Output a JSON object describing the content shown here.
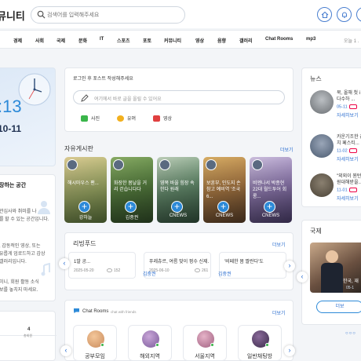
{
  "header": {
    "brand": "뮤니티",
    "search_placeholder": "검색어를 입력해주세요"
  },
  "nav": {
    "items": [
      "경제",
      "사회",
      "국제",
      "문화",
      "IT",
      "스포츠",
      "포토",
      "커뮤니티",
      "영상",
      "음향",
      "갤러리",
      "Chat Rooms",
      "mp3"
    ],
    "date": "오늘 1 ."
  },
  "clock": {
    "time": ":13",
    "date": "10-11"
  },
  "intro": {
    "title": "장하는 공간",
    "line1": "관심사와 취미를 나",
    "line2": "를 할 수 있는 공간입니다.",
    "line3": ", 감동적인 영상, 또는",
    "line4": "유롭게 업로드하고 감상",
    "line5": "갤러리입니다.",
    "line6": "미니, 회원 활동 소식",
    "line7": "보를 놓치지 마세요."
  },
  "stat": {
    "value": "4",
    "label": "총회원"
  },
  "post": {
    "title": "로그인 후 포스트 작성해주세요",
    "placeholder": "여기에서 바로 글을 올릴 수 있어요",
    "photo": "사진",
    "humor": "유머",
    "video": "영상"
  },
  "board": {
    "title": "자유게시판",
    "more": "더보기",
    "cards": [
      {
        "text": "해시마우스 팬...",
        "author": "강하늘"
      },
      {
        "text": "화장한 봄날을 거리 걷습니다다",
        "author": "김중권"
      },
      {
        "text": "영목 바울 힘장 속한다 원래",
        "author": "CNEWS"
      },
      {
        "text": "보훈부, 인도지 손 참고 예비역 '조국 6...",
        "author": "CNEWS"
      },
      {
        "text": "비엔나서 박종현 22대 월드투어 회롱...",
        "author": "CNEWS"
      }
    ]
  },
  "feed": {
    "title": "리빙푸드",
    "more": "더보기",
    "items": [
      {
        "title": "1말 공...",
        "date": "2025-05-20",
        "views": "152",
        "author": ""
      },
      {
        "title": "푸레츄르, 여름 맞이 펑수 신제...",
        "date": "2025-06-10",
        "views": "261",
        "author": "김중권"
      },
      {
        "title": "'비페한 봄 짤란다'도",
        "date": "",
        "views": "",
        "author": "김중권"
      }
    ]
  },
  "chat": {
    "title": "Chat Rooms",
    "subtitle": "chat with friends",
    "more": "더보기",
    "rooms": [
      "공부모임",
      "해외지역",
      "서울지역",
      "일반채팅방"
    ]
  },
  "right_top": {
    "title": "뉴스",
    "items": [
      {
        "text": "북, 올해 첫 i 를 다수하 ...",
        "date": "05-11",
        "link": "자세히보기"
      },
      {
        "text": "카운기조한 김치 페스티...",
        "date": "11-02",
        "link": "자세히보기"
      },
      {
        "text": "\"외외이 뭔턴 참원대해받을..",
        "date": "11-01",
        "link": "자세히보기"
      }
    ]
  },
  "right_bottom": {
    "title": "국제",
    "caption": "한국, 재",
    "date": "05-1",
    "more": "더보"
  },
  "colors": {
    "accent": "#2d8ad8",
    "link": "#2d6fd0",
    "background": "#f3f5f8"
  }
}
